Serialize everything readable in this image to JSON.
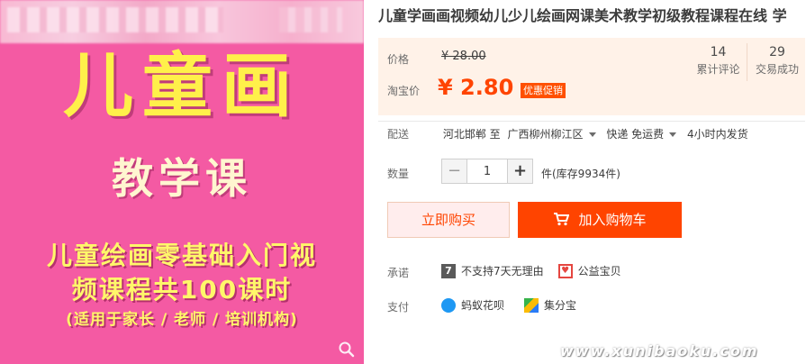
{
  "product": {
    "title": "儿童学画画视频幼儿少儿绘画网课美术教学初级教程课程在线 学",
    "image": {
      "title": "儿童画",
      "subtitle": "教学课",
      "line1": "儿童绘画零基础入门视",
      "line2": "频课程共100课时",
      "line3": "(适用于家长 / 老师 / 培训机构)",
      "zoom_icon": "magnifier-icon"
    }
  },
  "price": {
    "label": "价格",
    "original": "¥ 28.00",
    "taobao_label": "淘宝价",
    "taobao_price": "¥ 2.80",
    "promo_badge": "优惠促销"
  },
  "stats": {
    "reviews_count": "14",
    "reviews_label": "累计评论",
    "sales_count": "29",
    "sales_label": "交易成功"
  },
  "shipping": {
    "label": "配送",
    "from": "河北邯郸 至",
    "to": "广西柳州柳江区",
    "method": "快递 免运费",
    "dispatch": "4小时内发货"
  },
  "quantity": {
    "label": "数量",
    "value": "1",
    "minus": "−",
    "plus": "+",
    "stock": "件(库存9934件)"
  },
  "actions": {
    "buy_now": "立即购买",
    "add_cart": "加入购物车",
    "cart_icon": "cart-icon"
  },
  "promise": {
    "label": "承诺",
    "no_return": "不支持7天无理由",
    "no_return_icon_text": "7",
    "charity": "公益宝贝"
  },
  "payment": {
    "label": "支付",
    "huabei": "蚂蚁花呗",
    "jifenbao": "集分宝"
  },
  "watermark": "www.xunibaoku.com",
  "colors": {
    "accent": "#ff4400",
    "price_bg": "#fff2e8",
    "image_bg": "#f45aa3"
  }
}
